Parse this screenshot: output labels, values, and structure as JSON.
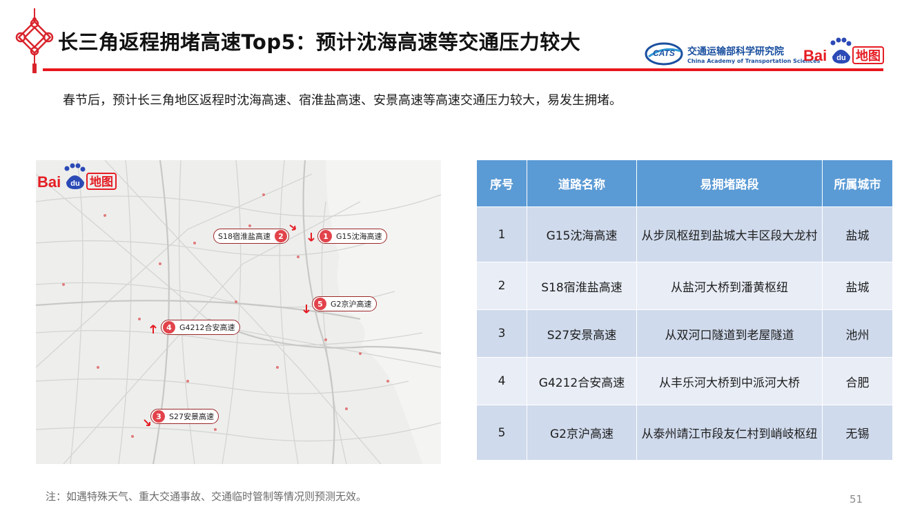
{
  "header": {
    "title": "长三角返程拥堵高速Top5：预计沈海高速等交通压力较大",
    "org_name_cn": "交通运输部科学研究院",
    "org_name_en": "China Academy of Transportation Sciences",
    "org_logo_text": "CATS",
    "baidu_logo_text": "Bai du 地图"
  },
  "subtitle": "春节后，预计长三角地区返程时沈海高速、宿淮盐高速、安景高速等高速交通压力较大，易发生拥堵。",
  "map": {
    "logo_text": "Bai du 地图",
    "markers": [
      {
        "num": "1",
        "label": "G15沈海高速"
      },
      {
        "num": "2",
        "label": "S18宿淮盐高速"
      },
      {
        "num": "3",
        "label": "S27安景高速"
      },
      {
        "num": "4",
        "label": "G4212合安高速"
      },
      {
        "num": "5",
        "label": "G2京沪高速"
      }
    ]
  },
  "table": {
    "headers": [
      "序号",
      "道路名称",
      "易拥堵路段",
      "所属城市"
    ],
    "rows": [
      {
        "no": "1",
        "road": "G15沈海高速",
        "section": "从步凤枢纽到盐城大丰区段大龙村",
        "city": "盐城"
      },
      {
        "no": "2",
        "road": "S18宿淮盐高速",
        "section": "从盐河大桥到潘黄枢纽",
        "city": "盐城"
      },
      {
        "no": "3",
        "road": "S27安景高速",
        "section": "从双河口隧道到老屋隧道",
        "city": "池州"
      },
      {
        "no": "4",
        "road": "G4212合安高速",
        "section": "从丰乐河大桥到中派河大桥",
        "city": "合肥"
      },
      {
        "no": "5",
        "road": "G2京沪高速",
        "section": "从泰州靖江市段友仁村到峭岐枢纽",
        "city": "无锡"
      }
    ]
  },
  "footer": {
    "note": "注：如遇特殊天气、重大交通事故、交通临时管制等情况则预测无效。",
    "page_number": "51"
  },
  "colors": {
    "accent_red": "#e8161d",
    "table_header": "#5b9bd5",
    "row_odd": "#cfdaec",
    "row_even": "#e8edf6",
    "marker_red": "#e2434b",
    "org_blue": "#1a4f9f"
  }
}
